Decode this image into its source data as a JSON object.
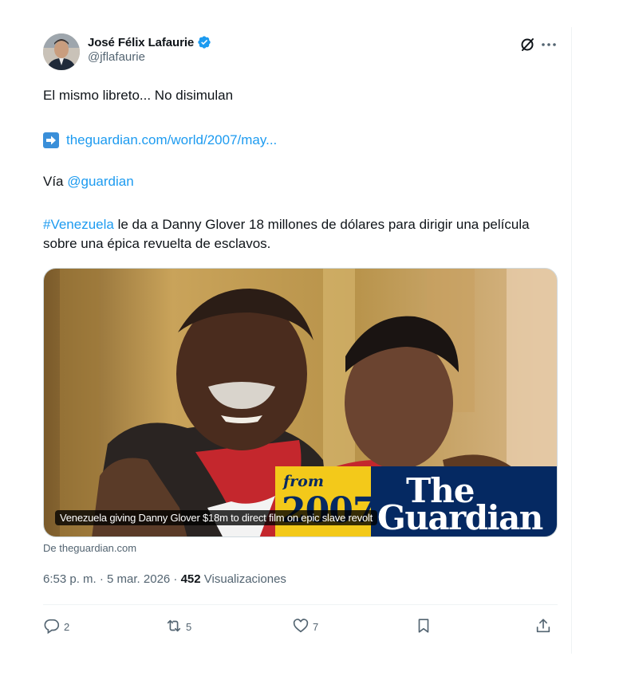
{
  "author": {
    "display_name": "José Félix Lafaurie",
    "handle": "@jflafaurie"
  },
  "tweet": {
    "line1": "El mismo libreto... No disimulan",
    "link_text": "theguardian.com/world/2007/may...",
    "via_prefix": "Vía ",
    "via_mention": "@guardian",
    "hashtag": "#Venezuela",
    "body_rest": " le da a Danny Glover 18 millones de dólares para dirigir una película sobre una épica revuelta de esclavos."
  },
  "card": {
    "caption": "Venezuela giving Danny Glover $18m to direct film on epic slave revolt",
    "brand_from": "from",
    "brand_year": "2007",
    "brand_the": "The",
    "brand_name": "Guardian",
    "source": "De theguardian.com"
  },
  "meta": {
    "time": "6:53 p. m. · 5 mar. 2026 · ",
    "views": "452",
    "views_label": " Visualizaciones"
  },
  "actions": {
    "replies": "2",
    "reposts": "5",
    "likes": "7"
  },
  "colors": {
    "link": "#1d9bf0",
    "muted": "#536471",
    "guardian_blue": "#052962",
    "guardian_yellow": "#f3c91a"
  },
  "icons": [
    "verified-icon",
    "grok-icon",
    "more-icon",
    "arrow-right-icon",
    "reply-icon",
    "repost-icon",
    "like-icon",
    "bookmark-icon",
    "share-icon"
  ]
}
